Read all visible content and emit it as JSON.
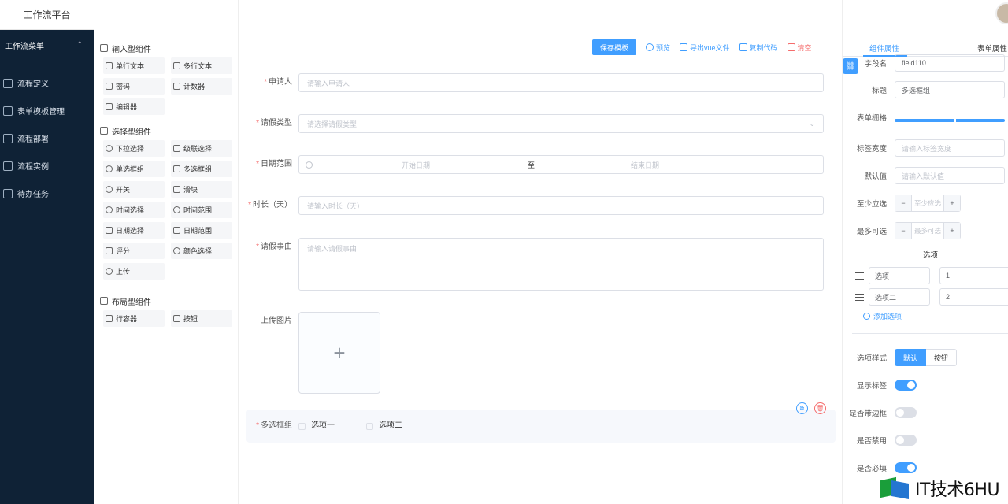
{
  "app": {
    "title": "工作流平台"
  },
  "nav": {
    "menu_title": "工作流菜单",
    "items": [
      {
        "label": "流程定义",
        "icon": "flow-icon"
      },
      {
        "label": "表单模板管理",
        "icon": "database-icon"
      },
      {
        "label": "流程部署",
        "icon": "calendar-icon"
      },
      {
        "label": "流程实例",
        "icon": "filter-icon"
      },
      {
        "label": "待办任务",
        "icon": "calendar-icon"
      }
    ]
  },
  "palette": {
    "groups": [
      {
        "title": "输入型组件",
        "items": [
          "单行文本",
          "多行文本",
          "密码",
          "计数器",
          "编辑器"
        ]
      },
      {
        "title": "选择型组件",
        "items": [
          "下拉选择",
          "级联选择",
          "单选框组",
          "多选框组",
          "开关",
          "滑块",
          "时间选择",
          "时间范围",
          "日期选择",
          "日期范围",
          "评分",
          "颜色选择",
          "上传"
        ]
      },
      {
        "title": "布局型组件",
        "items": [
          "行容器",
          "按钮"
        ]
      }
    ]
  },
  "toolbar": {
    "save": "保存模板",
    "preview": "预览",
    "export": "导出vue文件",
    "copy": "复制代码",
    "clear": "清空"
  },
  "form": {
    "fields": {
      "applicant": {
        "label": "申请人",
        "placeholder": "请输入申请人"
      },
      "leave_type": {
        "label": "请假类型",
        "placeholder": "请选择请假类型"
      },
      "date_range": {
        "label": "日期范围",
        "start": "开始日期",
        "sep": "至",
        "end": "结束日期"
      },
      "duration": {
        "label": "时长（天）",
        "placeholder": "请输入时长（天）"
      },
      "reason": {
        "label": "请假事由",
        "placeholder": "请输入请假事由"
      },
      "upload": {
        "label": "上传图片",
        "plus": "+"
      },
      "checkbox_group": {
        "label": "多选框组",
        "options": [
          "选项一",
          "选项二"
        ]
      }
    },
    "row_actions": {
      "copy": "⧉",
      "delete": "🗑"
    }
  },
  "props": {
    "tabs": {
      "component": "组件属性",
      "form": "表单属性"
    },
    "field_name": {
      "label": "字段名",
      "value": "field110"
    },
    "title": {
      "label": "标题",
      "value": "多选框组"
    },
    "grid": {
      "label": "表单栅格",
      "value_pct": 100
    },
    "label_width": {
      "label": "标签宽度",
      "placeholder": "请输入标签宽度"
    },
    "default_value": {
      "label": "默认值",
      "placeholder": "请输入默认值"
    },
    "min": {
      "label": "至少应选",
      "placeholder": "至少应选"
    },
    "max": {
      "label": "最多可选",
      "placeholder": "最多可选"
    },
    "options_title": "选项",
    "options": [
      {
        "label": "选项一",
        "value": "1"
      },
      {
        "label": "选项二",
        "value": "2"
      }
    ],
    "add_option": "添加选项",
    "option_style": {
      "label": "选项样式",
      "default": "默认",
      "button": "按钮"
    },
    "show_label": {
      "label": "显示标签",
      "on": true
    },
    "bordered": {
      "label": "是否带边框",
      "on": false
    },
    "disabled": {
      "label": "是否禁用",
      "on": false
    },
    "required": {
      "label": "是否必填",
      "on": true
    }
  },
  "watermark": {
    "text": "IT技术6HU"
  },
  "colors": {
    "primary": "#409eff",
    "danger": "#f56c6c",
    "nav_bg": "#0f2236"
  }
}
